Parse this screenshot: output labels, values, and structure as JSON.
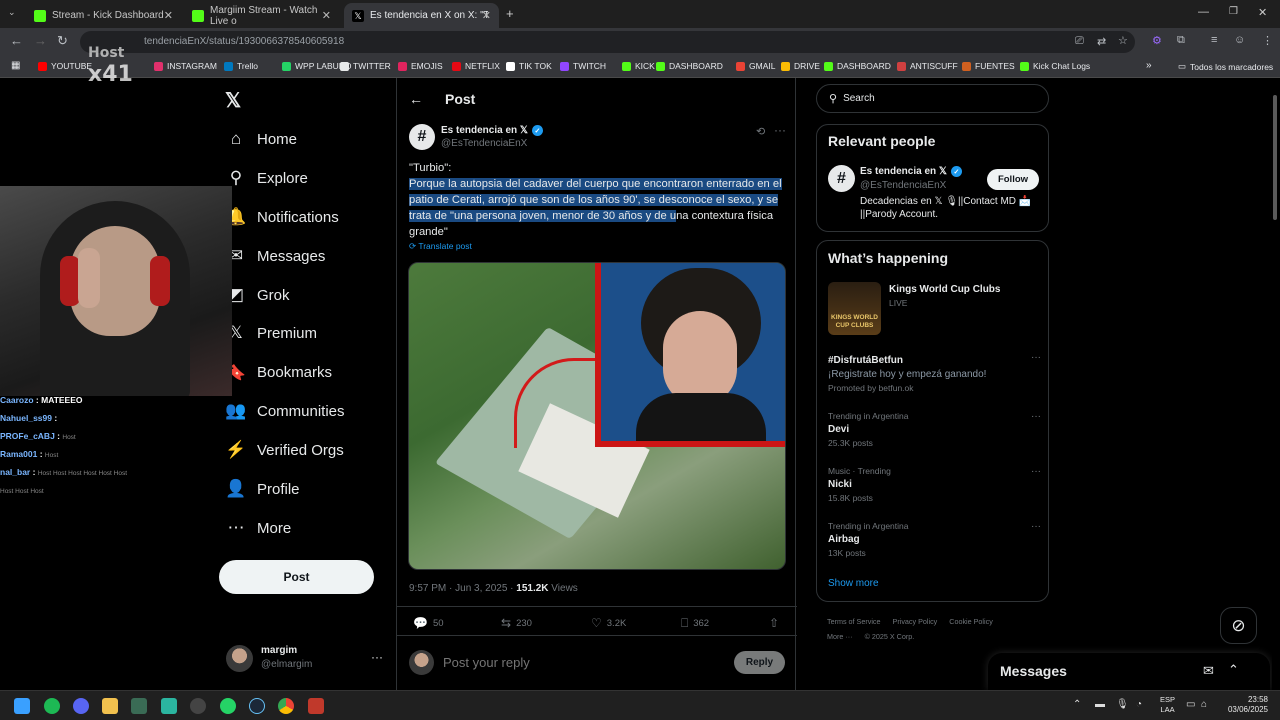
{
  "browser": {
    "tabs": [
      {
        "title": "Stream - Kick Dashboard",
        "favcolor": "#53fc18"
      },
      {
        "title": "Margiim Stream - Watch Live o",
        "favcolor": "#53fc18"
      },
      {
        "title": "Es tendencia en X on X: \"Turbi",
        "favcolor": "#e7e9ea"
      }
    ],
    "url": "tendenciaEnX/status/1930066378540605918",
    "bookmarks": [
      {
        "label": "YOUTUBE",
        "color": "#ff0000"
      },
      {
        "label": "INSTAGRAM",
        "color": "#e1306c"
      },
      {
        "label": "Trello",
        "color": "#0079bf"
      },
      {
        "label": "WPP LABURO",
        "color": "#25d366"
      },
      {
        "label": "TWITTER",
        "color": "#e7e9ea"
      },
      {
        "label": "EMOJIS",
        "color": "#e0245e"
      },
      {
        "label": "NETFLIX",
        "color": "#e50914"
      },
      {
        "label": "TIK TOK",
        "color": "#ffffff"
      },
      {
        "label": "TWITCH",
        "color": "#9146ff"
      },
      {
        "label": "KICK",
        "color": "#53fc18"
      },
      {
        "label": "DASHBOARD",
        "color": "#53fc18"
      },
      {
        "label": "GMAIL",
        "color": "#ea4335"
      },
      {
        "label": "DRIVE",
        "color": "#fbbc04"
      },
      {
        "label": "DASHBOARD",
        "color": "#53fc18"
      },
      {
        "label": "ANTISCUFF",
        "color": "#d04040"
      },
      {
        "label": "FUENTES",
        "color": "#d06020"
      },
      {
        "label": "Kick Chat Logs",
        "color": "#53fc18"
      }
    ],
    "all_bookmarks": "Todos los marcadores"
  },
  "stream": {
    "logo_line1": "Host",
    "logo_line2": "x41",
    "chat": [
      {
        "user": "Caarozo",
        "msg": "MATEEEO",
        "badges": ""
      },
      {
        "user": "Nahuel_ss99",
        "msg": "",
        "badges": ""
      },
      {
        "user": "PROFe_cABJ",
        "msg": "",
        "badges": "Host"
      },
      {
        "user": "Rama001",
        "msg": "",
        "badges": "Host"
      },
      {
        "user": "nal_bar",
        "msg": "",
        "badges": "Host  Host  Host  Host  Host  Host"
      },
      {
        "user": "",
        "msg": "",
        "badges": "Host  Host  Host"
      }
    ]
  },
  "nav": {
    "items": [
      {
        "label": "Home",
        "icon": "home-icon",
        "glyph": "⌂"
      },
      {
        "label": "Explore",
        "icon": "search-icon",
        "glyph": "⚲"
      },
      {
        "label": "Notifications",
        "icon": "bell-icon",
        "glyph": "🔔"
      },
      {
        "label": "Messages",
        "icon": "envelope-icon",
        "glyph": "✉"
      },
      {
        "label": "Grok",
        "icon": "grok-icon",
        "glyph": "◩"
      },
      {
        "label": "Premium",
        "icon": "x-premium-icon",
        "glyph": "𝕏"
      },
      {
        "label": "Bookmarks",
        "icon": "bookmark-icon",
        "glyph": "🔖"
      },
      {
        "label": "Communities",
        "icon": "people-icon",
        "glyph": "👥"
      },
      {
        "label": "Verified Orgs",
        "icon": "lightning-icon",
        "glyph": "⚡"
      },
      {
        "label": "Profile",
        "icon": "person-icon",
        "glyph": "👤"
      },
      {
        "label": "More",
        "icon": "more-circle-icon",
        "glyph": "⋯"
      }
    ],
    "post_button": "Post",
    "account": {
      "name": "margim",
      "handle": "@elmargim"
    }
  },
  "post": {
    "header": "Post",
    "author_name": "Es tendencia en 𝕏",
    "author_handle": "@EsTendenciaEnX",
    "text_first": "\"Turbio\":",
    "text_highlighted": "Porque la autopsia del cadaver del cuerpo que encontraron enterrado en el patio de Cerati, arrojó que son de los años 90', se desconoce el sexo, y se trata de \"una persona joven, menor de 30 años y de u",
    "text_rest": "na contextura física grande\"",
    "translate": "Translate post",
    "time": "9:57 PM · Jun 3, 2025 · ",
    "views_count": "151.2K",
    "views_label": " Views",
    "replies": "50",
    "reposts": "230",
    "likes": "3.2K",
    "bookmarks": "362",
    "reply_placeholder": "Post your reply",
    "reply_button": "Reply"
  },
  "right": {
    "search_placeholder": "Search",
    "relevant_title": "Relevant people",
    "relevant": {
      "name": "Es tendencia en 𝕏",
      "handle": "@EsTendenciaEnX",
      "follow": "Follow",
      "bio": "Decadencias en 𝕏 🎙||Contact MD 📩 ||Parody Account."
    },
    "happening_title": "What’s happening",
    "featured": {
      "title": "Kings World Cup Clubs",
      "status": "LIVE",
      "image_text": "KINGS WORLD CUP CLUBS"
    },
    "trends": [
      {
        "context": "#DisfrutáBetfun",
        "title": "¡Registrate hoy y empezá ganando!",
        "count": "Promoted by betfun.ok",
        "promo": true
      },
      {
        "context": "Trending in Argentina",
        "title": "Devi",
        "count": "25.3K posts"
      },
      {
        "context": "Music · Trending",
        "title": "Nicki",
        "count": "15.8K posts"
      },
      {
        "context": "Trending in Argentina",
        "title": "Airbag",
        "count": "13K posts"
      }
    ],
    "show_more": "Show more",
    "footer": [
      "Terms of Service",
      "Privacy Policy",
      "Cookie Policy",
      "More ···",
      "© 2025 X Corp."
    ],
    "messages": "Messages"
  },
  "taskbar": {
    "lang1": "ESP",
    "lang2": "LAA",
    "time": "23:58",
    "date": "03/06/2025"
  }
}
